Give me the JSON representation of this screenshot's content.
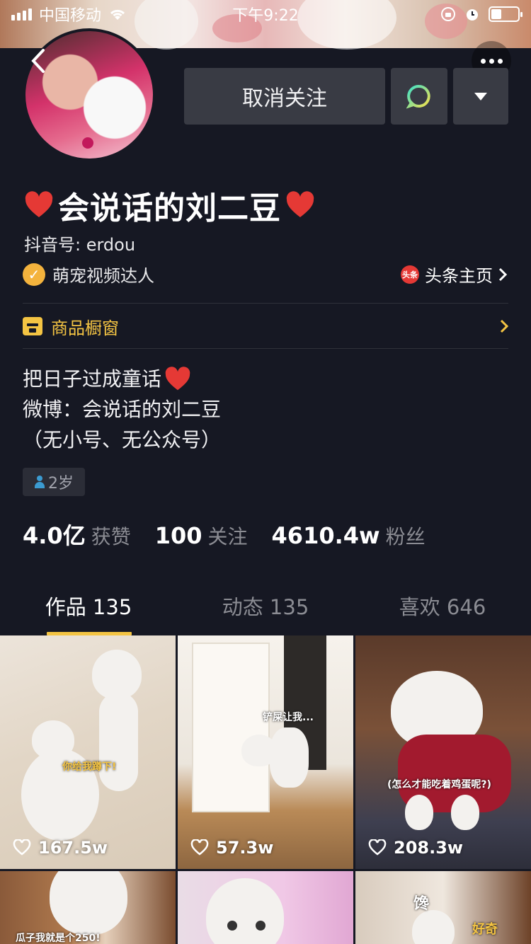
{
  "status_bar": {
    "carrier": "中国移动",
    "time": "下午9:22"
  },
  "header": {
    "unfollow_label": "取消关注"
  },
  "profile": {
    "name": "会说话的刘二豆",
    "douyin_id": "抖音号: erdou",
    "verification": "萌宠视频达人",
    "toutiao_icon_text": "头条",
    "toutiao_link": "头条主页",
    "shop_label": "商品橱窗",
    "bio": [
      "把日子过成童话",
      "微博：会说话的刘二豆",
      "（无小号、无公众号）"
    ],
    "age_tag": "2岁"
  },
  "stats": [
    {
      "value": "4.0亿",
      "label": "获赞"
    },
    {
      "value": "100",
      "label": "关注"
    },
    {
      "value": "4610.4w",
      "label": "粉丝"
    }
  ],
  "tabs": [
    {
      "label": "作品 135"
    },
    {
      "label": "动态 135"
    },
    {
      "label": "喜欢 646"
    }
  ],
  "videos": [
    {
      "likes": "167.5w",
      "caption": "你给我蹲下!"
    },
    {
      "likes": "57.3w",
      "caption": "铲屎让我..."
    },
    {
      "likes": "208.3w",
      "caption": "(怎么才能吃着鸡蛋呢?)"
    },
    {
      "likes": "",
      "caption": "瓜子我就是个250!"
    },
    {
      "likes": "",
      "caption": ""
    },
    {
      "likes": "",
      "caption": "馋",
      "caption2": "好奇"
    }
  ],
  "colors": {
    "background": "#161823",
    "accent": "#f4c443",
    "button": "#393b44",
    "heart": "#e53935"
  }
}
